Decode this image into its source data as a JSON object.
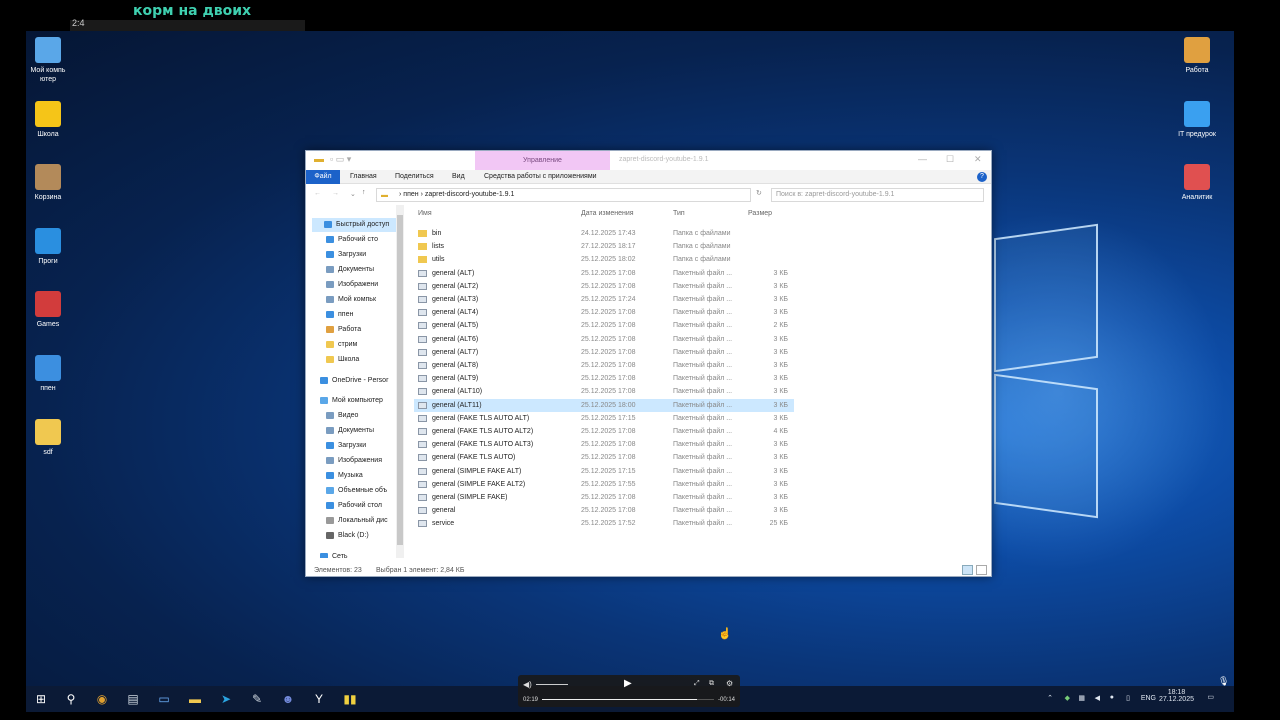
{
  "overlay": {
    "title": "корм на двоих",
    "bar_text": "2:4"
  },
  "desktop_icons_left": [
    {
      "label": "Мой компь ютер",
      "icon": "computer-icon",
      "color": "#5aa7e8"
    },
    {
      "label": "Школа",
      "icon": "star-icon",
      "color": "#f5c518"
    },
    {
      "label": "Корзина",
      "icon": "cat-icon",
      "color": "#b38a5a"
    },
    {
      "label": "Проги",
      "icon": "folder-blue-icon",
      "color": "#2a8fe0"
    },
    {
      "label": "Games",
      "icon": "games-icon",
      "color": "#d23c3c"
    },
    {
      "label": "ппен",
      "icon": "ie-icon",
      "color": "#3c8fe0"
    },
    {
      "label": "sdf",
      "icon": "file-icon",
      "color": "#f0c850"
    }
  ],
  "desktop_icons_right": [
    {
      "label": "Работа",
      "icon": "phone-icon",
      "color": "#e0a040"
    },
    {
      "label": "IT предурок",
      "icon": "play-icon",
      "color": "#3aa0f0"
    },
    {
      "label": "Аналитик",
      "icon": "analytics-icon",
      "color": "#e05050"
    }
  ],
  "explorer": {
    "manage_tab": "Управление",
    "window_title": "zapret-discord-youtube-1.9.1",
    "ribbon_tabs": [
      "Файл",
      "Главная",
      "Поделиться",
      "Вид",
      "Средства работы с приложениями"
    ],
    "address": [
      "ппен",
      "zapret-discord-youtube-1.9.1"
    ],
    "search_placeholder": "Поиск в: zapret-discord-youtube-1.9.1",
    "nav_items": [
      {
        "label": "Быстрый доступ",
        "color": "#3b8fe0"
      },
      {
        "label": "Рабочий сто",
        "color": "#3b8fe0"
      },
      {
        "label": "Загрузки",
        "color": "#3b8fe0"
      },
      {
        "label": "Документы",
        "color": "#7a9cc0"
      },
      {
        "label": "Изображени",
        "color": "#7a9cc0"
      },
      {
        "label": "Мой компьк",
        "color": "#7a9cc0"
      },
      {
        "label": "ппен",
        "color": "#3c8fe0"
      },
      {
        "label": "Работа",
        "color": "#e0a040"
      },
      {
        "label": "стрим",
        "color": "#f0c850"
      },
      {
        "label": "Школа",
        "color": "#f0c850"
      },
      {
        "label": "OneDrive - Persor",
        "color": "#3b8fe0"
      },
      {
        "label": "Мой компьютер",
        "color": "#5aa7e8"
      },
      {
        "label": "Видео",
        "color": "#7a9cc0"
      },
      {
        "label": "Документы",
        "color": "#7a9cc0"
      },
      {
        "label": "Загрузки",
        "color": "#3b8fe0"
      },
      {
        "label": "Изображения",
        "color": "#7a9cc0"
      },
      {
        "label": "Музыка",
        "color": "#3b8fe0"
      },
      {
        "label": "Объемные объ",
        "color": "#5aa7e8"
      },
      {
        "label": "Рабочий стол",
        "color": "#3b8fe0"
      },
      {
        "label": "Локальный дис",
        "color": "#999999"
      },
      {
        "label": "Black (D:)",
        "color": "#666666"
      },
      {
        "label": "Сеть",
        "color": "#3b8fe0"
      }
    ],
    "columns": [
      "Имя",
      "Дата изменения",
      "Тип",
      "Размер"
    ],
    "files": [
      {
        "name": "bin",
        "date": "24.12.2025 17:43",
        "type": "Папка с файлами",
        "size": "",
        "folder": true
      },
      {
        "name": "lists",
        "date": "27.12.2025 18:17",
        "type": "Папка с файлами",
        "size": "",
        "folder": true
      },
      {
        "name": "utils",
        "date": "25.12.2025 18:02",
        "type": "Папка с файлами",
        "size": "",
        "folder": true
      },
      {
        "name": "general (ALT)",
        "date": "25.12.2025 17:08",
        "type": "Пакетный файл ...",
        "size": "3 КБ"
      },
      {
        "name": "general (ALT2)",
        "date": "25.12.2025 17:08",
        "type": "Пакетный файл ...",
        "size": "3 КБ"
      },
      {
        "name": "general (ALT3)",
        "date": "25.12.2025 17:24",
        "type": "Пакетный файл ...",
        "size": "3 КБ"
      },
      {
        "name": "general (ALT4)",
        "date": "25.12.2025 17:08",
        "type": "Пакетный файл ...",
        "size": "3 КБ"
      },
      {
        "name": "general (ALT5)",
        "date": "25.12.2025 17:08",
        "type": "Пакетный файл ...",
        "size": "2 КБ"
      },
      {
        "name": "general (ALT6)",
        "date": "25.12.2025 17:08",
        "type": "Пакетный файл ...",
        "size": "3 КБ"
      },
      {
        "name": "general (ALT7)",
        "date": "25.12.2025 17:08",
        "type": "Пакетный файл ...",
        "size": "3 КБ"
      },
      {
        "name": "general (ALT8)",
        "date": "25.12.2025 17:08",
        "type": "Пакетный файл ...",
        "size": "3 КБ"
      },
      {
        "name": "general (ALT9)",
        "date": "25.12.2025 17:08",
        "type": "Пакетный файл ...",
        "size": "3 КБ"
      },
      {
        "name": "general (ALT10)",
        "date": "25.12.2025 17:08",
        "type": "Пакетный файл ...",
        "size": "3 КБ"
      },
      {
        "name": "general (ALT11)",
        "date": "25.12.2025 18:00",
        "type": "Пакетный файл ...",
        "size": "3 КБ",
        "selected": true
      },
      {
        "name": "general (FAKE TLS AUTO ALT)",
        "date": "25.12.2025 17:15",
        "type": "Пакетный файл ...",
        "size": "3 КБ"
      },
      {
        "name": "general (FAKE TLS AUTO ALT2)",
        "date": "25.12.2025 17:08",
        "type": "Пакетный файл ...",
        "size": "4 КБ"
      },
      {
        "name": "general (FAKE TLS AUTO ALT3)",
        "date": "25.12.2025 17:08",
        "type": "Пакетный файл ...",
        "size": "3 КБ"
      },
      {
        "name": "general (FAKE TLS AUTO)",
        "date": "25.12.2025 17:08",
        "type": "Пакетный файл ...",
        "size": "3 КБ"
      },
      {
        "name": "general (SIMPLE FAKE ALT)",
        "date": "25.12.2025 17:15",
        "type": "Пакетный файл ...",
        "size": "3 КБ"
      },
      {
        "name": "general (SIMPLE FAKE ALT2)",
        "date": "25.12.2025 17:55",
        "type": "Пакетный файл ...",
        "size": "3 КБ"
      },
      {
        "name": "general (SIMPLE FAKE)",
        "date": "25.12.2025 17:08",
        "type": "Пакетный файл ...",
        "size": "3 КБ"
      },
      {
        "name": "general",
        "date": "25.12.2025 17:08",
        "type": "Пакетный файл ...",
        "size": "3 КБ"
      },
      {
        "name": "service",
        "date": "25.12.2025 17:52",
        "type": "Пакетный файл ...",
        "size": "25 КБ"
      }
    ],
    "status_count": "Элементов: 23",
    "status_selected": "Выбран 1 элемент: 2,84 КБ"
  },
  "player": {
    "time_elapsed": "02:19",
    "time_remaining": "-00:14",
    "progress": 0.9
  },
  "taskbar": {
    "icons": [
      {
        "name": "start-icon",
        "glyph": "⊞",
        "color": "#ffffff"
      },
      {
        "name": "search-icon",
        "glyph": "⚲",
        "color": "#ffffff"
      },
      {
        "name": "chrome-icon",
        "glyph": "◉",
        "color": "#e0a030"
      },
      {
        "name": "notepad-icon",
        "glyph": "▤",
        "color": "#cfd8e0"
      },
      {
        "name": "window-icon",
        "glyph": "▭",
        "color": "#6fb4ff"
      },
      {
        "name": "explorer-icon",
        "glyph": "▬",
        "color": "#f0c850"
      },
      {
        "name": "telegram-icon",
        "glyph": "➤",
        "color": "#2aa3e0"
      },
      {
        "name": "steam-icon",
        "glyph": "✎",
        "color": "#cfd8e0"
      },
      {
        "name": "discord-icon",
        "glyph": "☻",
        "color": "#7289da"
      },
      {
        "name": "yandex-icon",
        "glyph": "Y",
        "color": "#ffffff"
      },
      {
        "name": "pause-app-icon",
        "glyph": "▮▮",
        "color": "#f0d040"
      }
    ],
    "lang": "ENG",
    "time": "18:18",
    "date": "27.12.2025"
  }
}
